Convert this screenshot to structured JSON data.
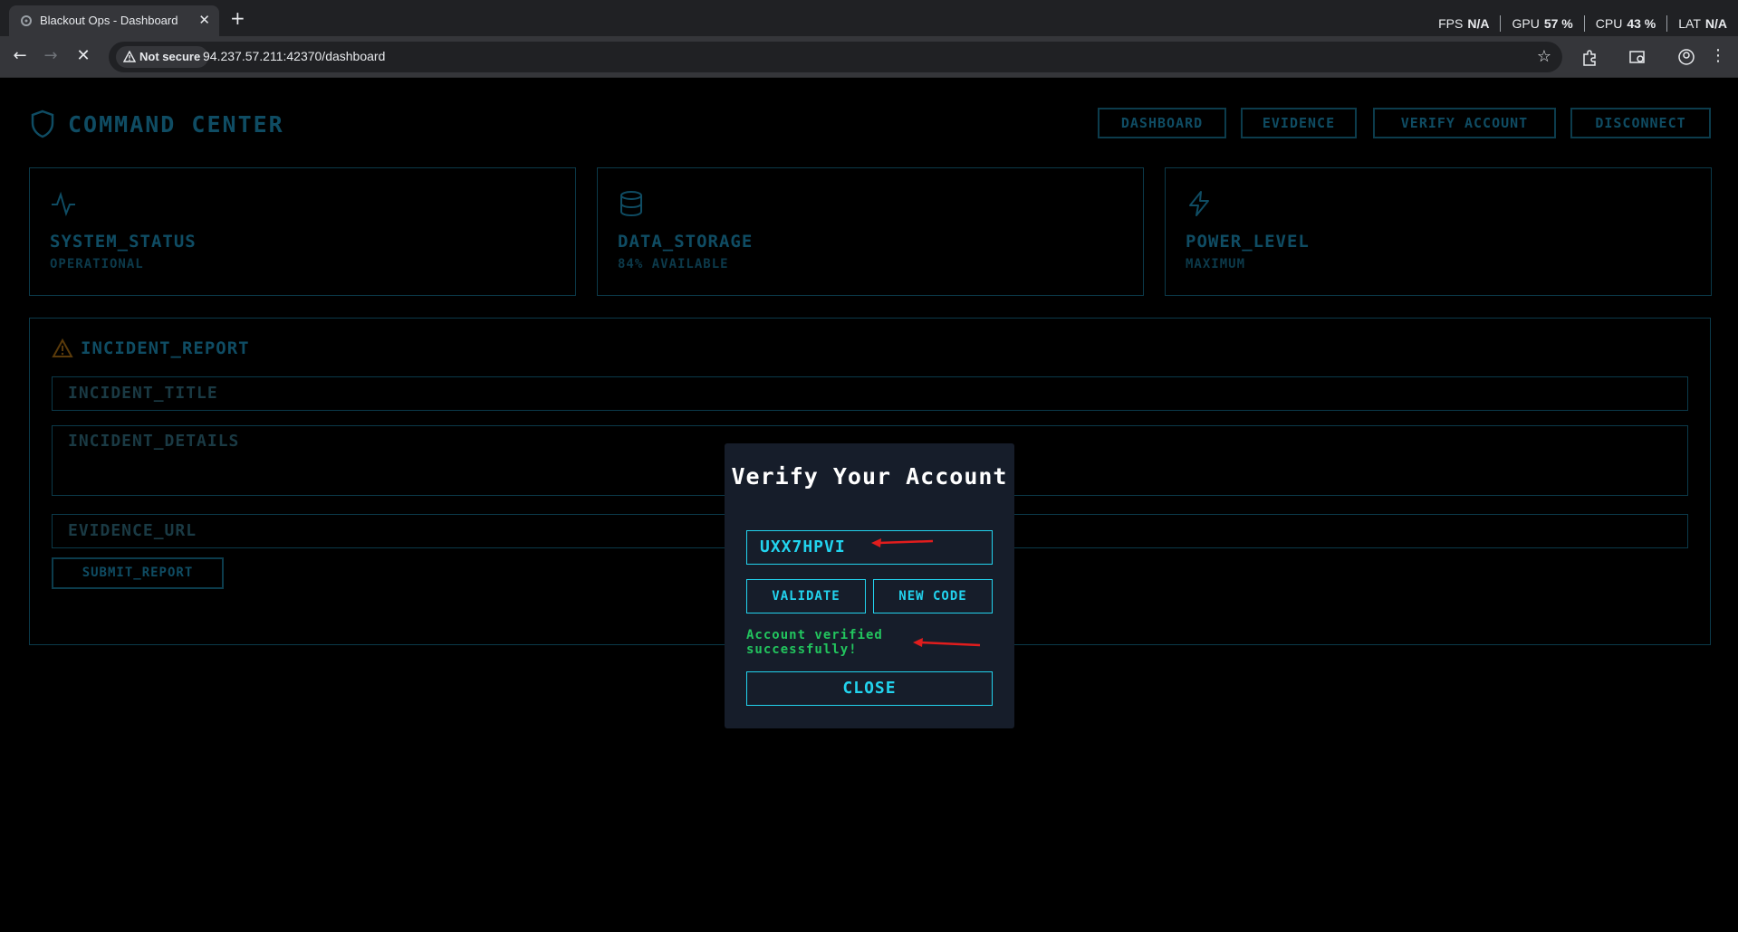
{
  "browser": {
    "tab_title": "Blackout Ops - Dashboard",
    "new_tab": "+",
    "not_secure": "Not secure",
    "url": "94.237.57.211:42370/dashboard",
    "perf": {
      "fps_label": "FPS",
      "fps_value": "N/A",
      "gpu_label": "GPU",
      "gpu_value": "57 %",
      "cpu_label": "CPU",
      "cpu_value": "43 %",
      "lat_label": "LAT",
      "lat_value": "N/A"
    }
  },
  "header": {
    "title": "COMMAND CENTER",
    "nav": [
      "DASHBOARD",
      "EVIDENCE",
      "VERIFY ACCOUNT",
      "DISCONNECT"
    ]
  },
  "cards": [
    {
      "icon": "activity-icon",
      "title": "SYSTEM_STATUS",
      "subtitle": "OPERATIONAL"
    },
    {
      "icon": "database-icon",
      "title": "DATA_STORAGE",
      "subtitle": "84% AVAILABLE"
    },
    {
      "icon": "lightning-icon",
      "title": "POWER_LEVEL",
      "subtitle": "MAXIMUM"
    }
  ],
  "incident": {
    "title": "INCIDENT_REPORT",
    "title_placeholder": "INCIDENT_TITLE",
    "details_placeholder": "INCIDENT_DETAILS",
    "url_placeholder": "EVIDENCE_URL",
    "submit": "SUBMIT_REPORT"
  },
  "modal": {
    "title": "Verify Your Account",
    "code": "UXX7HPVI",
    "validate": "VALIDATE",
    "new_code": "NEW CODE",
    "message": "Account verified successfully!",
    "close": "CLOSE"
  },
  "colors": {
    "accent": "#22d3ee",
    "success": "#22c55e",
    "annotation": "#e11d1d",
    "dim": "#0f4c63"
  }
}
